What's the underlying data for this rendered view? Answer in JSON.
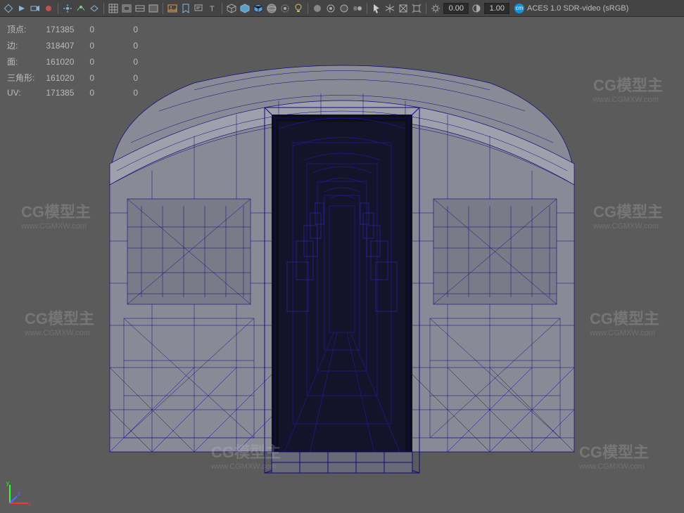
{
  "toolbar": {
    "num1": "0.00",
    "num2": "1.00",
    "color_mgmt_label": "ACES 1.0 SDR-video (sRGB)"
  },
  "stats": {
    "rows": [
      {
        "label": "顶点:",
        "c1": "171385",
        "c2": "0",
        "c3": "0"
      },
      {
        "label": "边:",
        "c1": "318407",
        "c2": "0",
        "c3": "0"
      },
      {
        "label": "面:",
        "c1": "161020",
        "c2": "0",
        "c3": "0"
      },
      {
        "label": "三角形:",
        "c1": "161020",
        "c2": "0",
        "c3": "0"
      },
      {
        "label": "UV:",
        "c1": "171385",
        "c2": "0",
        "c3": "0"
      }
    ]
  },
  "axis": {
    "x": "x",
    "y": "y",
    "z": "z"
  },
  "watermark": {
    "logo": "CG模型主",
    "url": "www.CGMXW.com"
  }
}
